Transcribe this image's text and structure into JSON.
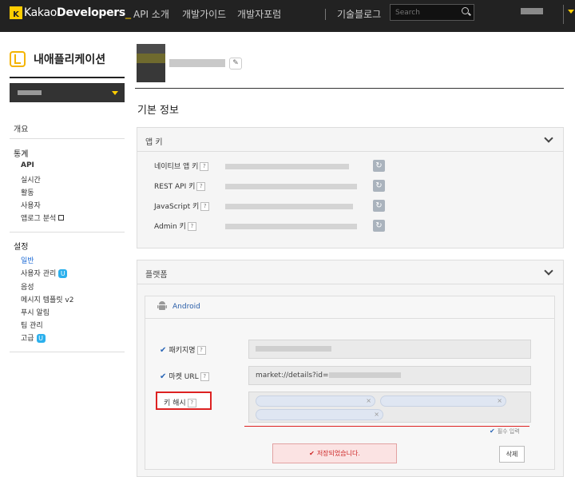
{
  "topbar": {
    "logo_k": "K",
    "logo_text_light": "Kakao",
    "logo_text_bold": "Developers",
    "logo_suffix": "_",
    "nav": [
      "API 소개",
      "개발가이드",
      "개발자포럼",
      "기술블로그"
    ],
    "search_placeholder": "Search"
  },
  "sidebar": {
    "title": "내애플리케이션",
    "overview": "개요",
    "stats_head": "통계",
    "stats_items": [
      "API",
      "실시간",
      "활동",
      "사용자",
      "앱로그 분석"
    ],
    "settings_head": "설정",
    "settings_items": [
      "일반",
      "사용자 관리",
      "음성",
      "메시지 템플릿 v2",
      "푸시 알림",
      "팀 관리",
      "고급"
    ],
    "badge": "U"
  },
  "main": {
    "section_title": "기본 정보",
    "app_keys_panel": {
      "title": "앱 키",
      "rows": [
        "네이티브 앱 키",
        "REST API 키",
        "JavaScript 키",
        "Admin 키"
      ]
    },
    "platform_panel": {
      "title": "플랫폼",
      "platform": "Android",
      "package_label": "패키지명",
      "market_label": "마켓 URL",
      "market_value": "market://details?id=",
      "keyhash_label": "키 해시",
      "required_note": "필수 입력",
      "saved_message": "저장되었습니다.",
      "delete_label": "삭제"
    },
    "help_mark": "?"
  },
  "colors": {
    "brand_yellow": "#ffcd00",
    "topbar_bg": "#222222",
    "link_blue": "#1f6cd6",
    "error_red": "#dd2222"
  }
}
